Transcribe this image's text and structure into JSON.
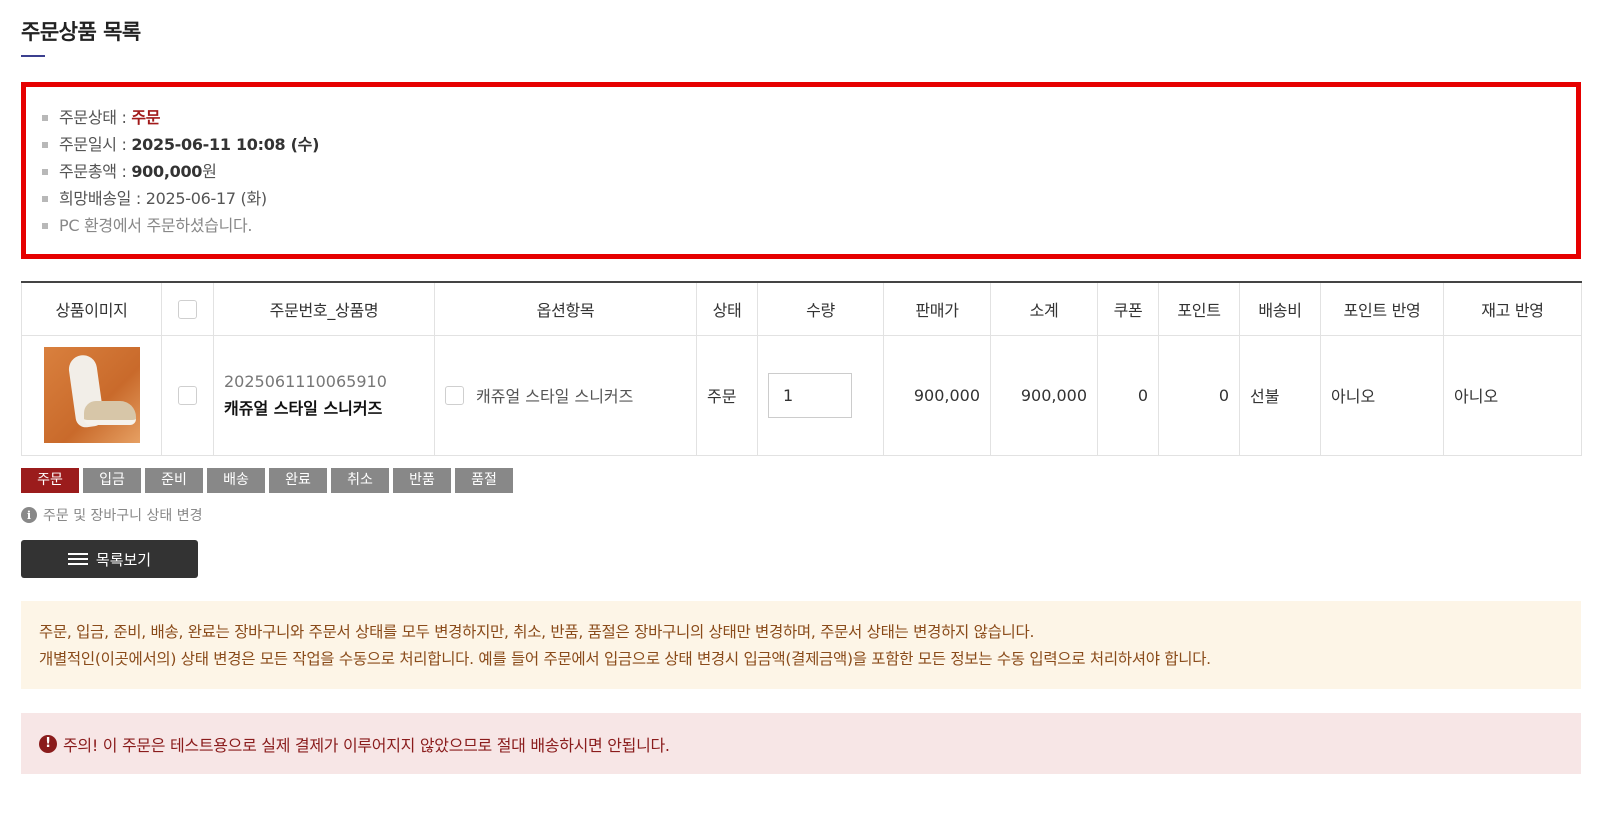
{
  "section": {
    "title": "주문상품 목록"
  },
  "summary": {
    "status_label": "주문상태 : ",
    "status_value": "주문",
    "date_label": "주문일시 : ",
    "date_value": "2025-06-11 10:08 (수)",
    "total_label": "주문총액 : ",
    "total_value": "900,000",
    "total_unit": "원",
    "delivery_label": "희망배송일 : ",
    "delivery_value": "2025-06-17 (화)",
    "env_note": "PC 환경에서 주문하셨습니다."
  },
  "table": {
    "headers": [
      "상품이미지",
      "",
      "주문번호_상품명",
      "옵션항목",
      "상태",
      "수량",
      "판매가",
      "소계",
      "쿠폰",
      "포인트",
      "배송비",
      "포인트 반영",
      "재고 반영"
    ],
    "row": {
      "order_no": "2025061110065910",
      "product_name": "캐쥬얼 스타일 스니커즈",
      "option": "캐쥬얼 스타일 스니커즈",
      "status": "주문",
      "quantity": "1",
      "price": "900,000",
      "subtotal": "900,000",
      "coupon": "0",
      "point": "0",
      "shipping": "선불",
      "point_applied": "아니오",
      "stock_applied": "아니오"
    }
  },
  "status_buttons": [
    "주문",
    "입금",
    "준비",
    "배송",
    "완료",
    "취소",
    "반품",
    "품절"
  ],
  "hint": {
    "icon": "info-icon",
    "text": "주문 및 장바구니 상태 변경"
  },
  "list_button": {
    "icon": "list-icon",
    "label": "목록보기"
  },
  "notice": {
    "line1": "주문, 입금, 준비, 배송, 완료는 장바구니와 주문서 상태를 모두 변경하지만, 취소, 반품, 품절은 장바구니의 상태만 변경하며, 주문서 상태는 변경하지 않습니다.",
    "line2": "개별적인(이곳에서의) 상태 변경은 모든 작업을 수동으로 처리합니다. 예를 들어 주문에서 입금으로 상태 변경시 입금액(결제금액)을 포함한 모든 정보는 수동 입력으로 처리하셔야 합니다."
  },
  "warning": {
    "icon": "exclamation-icon",
    "text": "주의! 이 주문은 테스트용으로 실제 결제가 이루어지지 않았으므로 절대 배송하시면 안됩니다."
  },
  "colors": {
    "highlight_border": "#e60000",
    "active_status": "#9b1c1c",
    "inactive_status": "#888888",
    "notice_bg": "#fdf5e7",
    "warning_bg": "#f7e6e6"
  }
}
